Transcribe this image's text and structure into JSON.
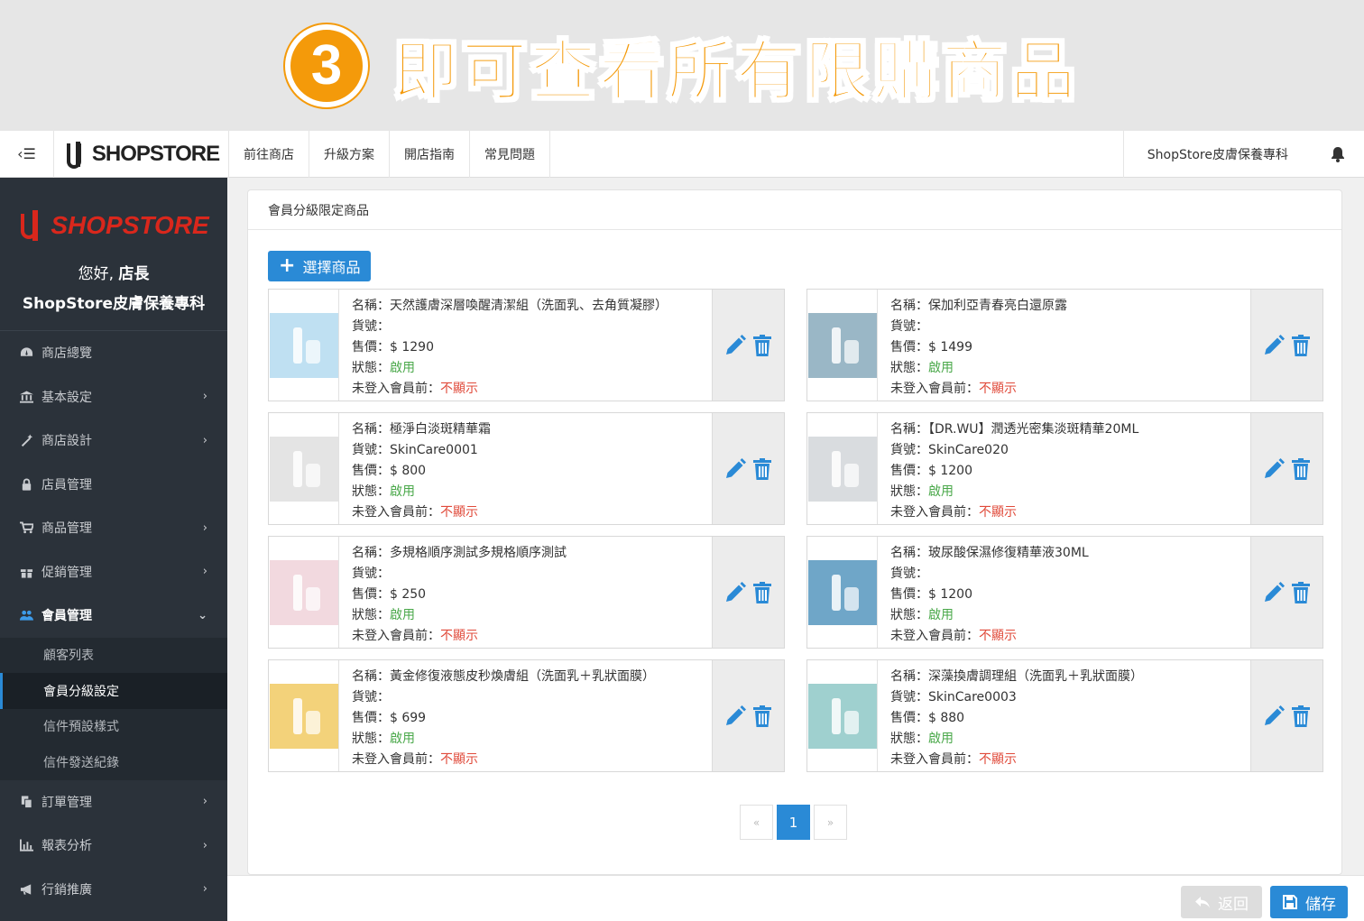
{
  "banner": {
    "step": "3",
    "title": "即可查看所有限購商品"
  },
  "topnav": {
    "logo": "SHOPSTORE",
    "links": [
      "前往商店",
      "升級方案",
      "開店指南",
      "常見問題"
    ],
    "store_name": "ShopStore皮膚保養專科"
  },
  "sidebar": {
    "logo": "SHOPSTORE",
    "greeting_prefix": "您好,",
    "greeting_name": "店長",
    "store_name": "ShopStore皮膚保養專科",
    "items": [
      {
        "label": "商店總覽",
        "icon": "dashboard-icon"
      },
      {
        "label": "基本設定",
        "icon": "bank-icon"
      },
      {
        "label": "商店設計",
        "icon": "magic-wand-icon"
      },
      {
        "label": "店員管理",
        "icon": "lock-icon"
      },
      {
        "label": "商品管理",
        "icon": "cart-icon"
      },
      {
        "label": "促銷管理",
        "icon": "gift-icon"
      },
      {
        "label": "會員管理",
        "icon": "users-icon"
      },
      {
        "label": "訂單管理",
        "icon": "copy-icon"
      },
      {
        "label": "報表分析",
        "icon": "bar-chart-icon"
      },
      {
        "label": "行銷推廣",
        "icon": "bullhorn-icon"
      }
    ],
    "submenu": [
      "顧客列表",
      "會員分級設定",
      "信件預設樣式",
      "信件發送紀錄"
    ]
  },
  "panel": {
    "title": "會員分級限定商品",
    "select_button": "選擇商品",
    "labels": {
      "name": "名稱：",
      "sku": "貨號：",
      "price": "售價：$ ",
      "status": "狀態：",
      "guest": "未登入會員前："
    },
    "products": [
      {
        "name": "天然護膚深層喚醒清潔組（洗面乳、去角質凝膠）",
        "sku": "",
        "price": "1290",
        "status": "啟用",
        "guest": "不顯示",
        "thumb_color": "#bfe0f2"
      },
      {
        "name": "保加利亞青春亮白還原露",
        "sku": "",
        "price": "1499",
        "status": "啟用",
        "guest": "不顯示",
        "thumb_color": "#9ab7c6"
      },
      {
        "name": "極淨白淡斑精華霜",
        "sku": "SkinCare0001",
        "price": "800",
        "status": "啟用",
        "guest": "不顯示",
        "thumb_color": "#e4e4e4"
      },
      {
        "name": "【DR.WU】潤透光密集淡斑精華20ML",
        "sku": "SkinCare020",
        "price": "1200",
        "status": "啟用",
        "guest": "不顯示",
        "thumb_color": "#d9dcdf"
      },
      {
        "name": "多規格順序測試多規格順序測試",
        "sku": "",
        "price": "250",
        "status": "啟用",
        "guest": "不顯示",
        "thumb_color": "#f2d9df"
      },
      {
        "name": "玻尿酸保濕修復精華液30ML",
        "sku": "",
        "price": "1200",
        "status": "啟用",
        "guest": "不顯示",
        "thumb_color": "#6fa6c8"
      },
      {
        "name": "黃金修復液態皮秒煥膚組（洗面乳＋乳狀面膜）",
        "sku": "",
        "price": "699",
        "status": "啟用",
        "guest": "不顯示",
        "thumb_color": "#f3d27a"
      },
      {
        "name": "深藻換膚調理組（洗面乳＋乳狀面膜）",
        "sku": "SkinCare0003",
        "price": "880",
        "status": "啟用",
        "guest": "不顯示",
        "thumb_color": "#9fd0cf"
      }
    ]
  },
  "pager": {
    "prev": "«",
    "current": "1",
    "next": "»"
  },
  "footer": {
    "back": "返回",
    "save": "儲存"
  },
  "colors": {
    "primary": "#2a8ad6",
    "orange": "#f49a0a",
    "sidebar": "#2b323a",
    "ok": "#4aa84a",
    "no": "#e04a3a"
  }
}
